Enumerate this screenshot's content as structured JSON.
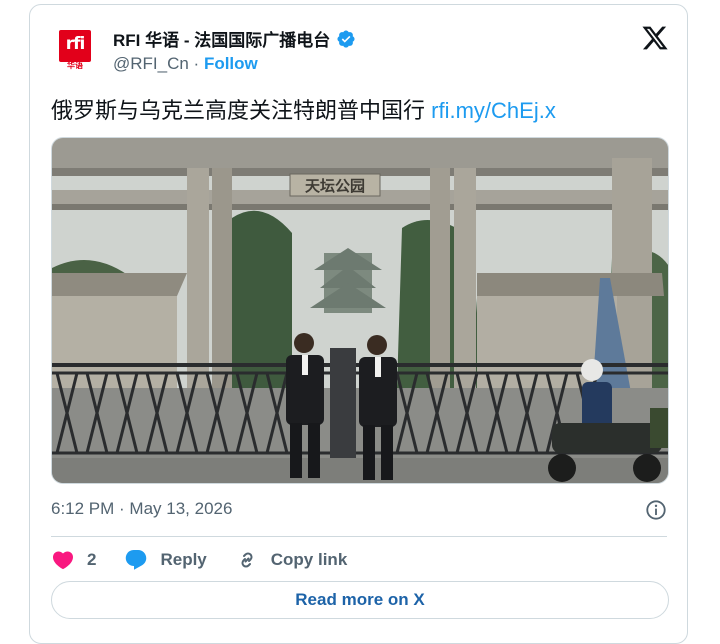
{
  "account": {
    "display_name": "RFI 华语 - 法国国际广播电台",
    "handle": "@RFI_Cn",
    "separator": " · ",
    "follow_label": "Follow",
    "avatar_logo_text": "rfi",
    "avatar_logo_subtext": "华语"
  },
  "tweet": {
    "text": "俄罗斯与乌克兰高度关注特朗普中国行",
    "link": "rfi.my/ChEj.x",
    "gate_sign_text": "天坛公园"
  },
  "meta": {
    "timestamp": "6:12 PM · May 13, 2026"
  },
  "actions": {
    "like_count": "2",
    "reply_label": "Reply",
    "copy_link_label": "Copy link"
  },
  "footer": {
    "read_more_label": "Read more on X"
  },
  "colors": {
    "accent_blue": "#1d9bf0",
    "like_pink": "#f91880",
    "rfi_red": "#e2001a",
    "text_primary": "#0f1419",
    "text_secondary": "#536471"
  },
  "icons": {
    "verified": "verified-badge-icon",
    "x_logo": "x-logo-icon",
    "info": "info-icon",
    "like": "heart-icon",
    "reply": "speech-bubble-icon",
    "copy_link": "link-icon"
  }
}
